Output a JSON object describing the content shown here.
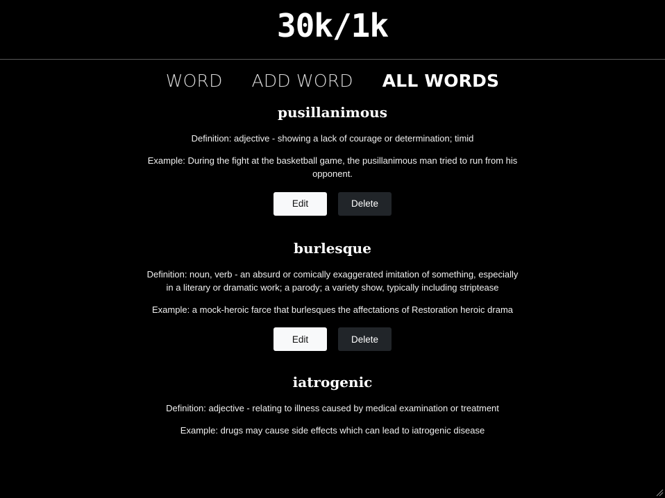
{
  "header": {
    "logo": "30k/1k"
  },
  "nav": {
    "items": [
      {
        "label": "WORD"
      },
      {
        "label": "ADD WORD"
      },
      {
        "label": "ALL WORDS"
      }
    ],
    "active": "ALL WORDS"
  },
  "words": [
    {
      "title": "pusillanimous",
      "definition": "Definition: adjective - showing a lack of courage or determination; timid",
      "example": "Example: During the fight at the basketball game, the pusillanimous man tried to run from his opponent.",
      "edit_label": "Edit",
      "delete_label": "Delete"
    },
    {
      "title": "burlesque",
      "definition": "Definition: noun, verb - an absurd or comically exaggerated imitation of something, especially in a literary or dramatic work; a parody; a variety show, typically including striptease",
      "example": "Example: a mock-heroic farce that burlesques the affectations of Restoration heroic drama",
      "edit_label": "Edit",
      "delete_label": "Delete"
    },
    {
      "title": "iatrogenic",
      "definition": "Definition: adjective - relating to illness caused by medical examination or treatment",
      "example": "Example: drugs may cause side effects which can lead to iatrogenic disease"
    }
  ],
  "colors": {
    "background": "#000000",
    "text": "#ffffff",
    "edit_button_bg": "#f8f9fa",
    "delete_button_bg": "#212529"
  }
}
